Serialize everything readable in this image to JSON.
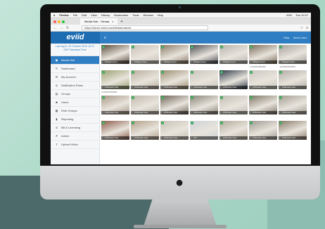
{
  "menubar": {
    "app": "Firefox",
    "items": [
      "File",
      "Edit",
      "View",
      "History",
      "Bookmarks",
      "Tools",
      "Window",
      "Help"
    ],
    "right_items": [
      "99%",
      "Tue 10:37"
    ]
  },
  "browser": {
    "tab_title": "Media Hub - Trimaa",
    "url": "https://demo.eviid.com/Media/Index#/",
    "nav_back": "←",
    "nav_forward": "→",
    "nav_reload": "↻",
    "menu_glyph": "≡",
    "star_glyph": "☆"
  },
  "app": {
    "logo": "eviid",
    "hamburger": "≡",
    "header_right": [
      "Help",
      "demo user"
    ],
    "last_login": "Last log in: 22 October 2019 10:37 GMT Standard Time"
  },
  "sidebar": {
    "items": [
      {
        "label": "Media Hub",
        "icon": "camera-icon",
        "glyph": "▣",
        "active": true
      },
      {
        "label": "Dashboard",
        "icon": "edit-icon",
        "glyph": "✎",
        "active": false
      },
      {
        "label": "My Account",
        "icon": "gear-icon",
        "glyph": "⚙",
        "active": false
      },
      {
        "label": "Notification Rules",
        "icon": "bell-icon",
        "glyph": "◎",
        "active": false
      },
      {
        "label": "Groups",
        "icon": "groups-icon",
        "glyph": "▤",
        "active": false
      },
      {
        "label": "Users",
        "icon": "users-icon",
        "glyph": "☻",
        "active": false
      },
      {
        "label": "Role Groups",
        "icon": "roles-icon",
        "glyph": "▦",
        "active": false
      },
      {
        "label": "Reporting",
        "icon": "chart-icon",
        "glyph": "▮",
        "active": false
      },
      {
        "label": "Bill & Licensing",
        "icon": "bill-icon",
        "glyph": "$",
        "active": false
      },
      {
        "label": "Admin",
        "icon": "wrench-icon",
        "glyph": "✗",
        "active": false
      },
      {
        "label": "Upload Video",
        "icon": "upload-icon",
        "glyph": "⇧",
        "active": false
      }
    ]
  },
  "media": {
    "rows": [
      {
        "thumbs": [
          {
            "caption": "8 Regent Court",
            "color": "#5a4a3a"
          },
          {
            "caption": "8 Regent Court",
            "color": "#c8c0b8"
          },
          {
            "caption": "8 Regent Court",
            "color": "#8a7a66"
          },
          {
            "caption": "8 Regent Court",
            "color": "#4a4a52"
          },
          {
            "caption": "8 Regent Court",
            "color": "#b8b4ae"
          },
          {
            "caption": "8 Regent Court",
            "color": "#7a6a58"
          },
          {
            "caption": "8 Regent Court",
            "color": "#a6a29c"
          }
        ],
        "labels": [
          "",
          "",
          "",
          "",
          "",
          "1234567890ABC",
          "1234567890ABC"
        ]
      },
      {
        "thumbs": [
          {
            "caption": "24 Brussel Crest",
            "color": "#9aa070"
          },
          {
            "caption": "24 Brussel Crest",
            "color": "#b8ae9c"
          },
          {
            "caption": "24 Brussel Crest",
            "color": "#9c8c70"
          },
          {
            "caption": "24 Brussel Crest",
            "color": "#c9c4bb"
          },
          {
            "caption": "24 Brussel Crest",
            "color": "#2e3a48"
          },
          {
            "caption": "24 Brussel Crest",
            "color": "#cbc7c0"
          },
          {
            "caption": "24 Brussel Crest",
            "color": "#b0aca5"
          }
        ],
        "labels": [
          "1234567890ABC",
          "",
          "",
          "",
          "",
          "",
          ""
        ]
      },
      {
        "thumbs": [
          {
            "caption": "24 Brussel Crest",
            "color": "#a89886"
          },
          {
            "caption": "24 Brussel Crest",
            "color": "#bfb8ab"
          },
          {
            "caption": "24 Brussel Crest",
            "color": "#6e6458"
          },
          {
            "caption": "24 Brussel Crest",
            "color": "#8a8478"
          },
          {
            "caption": "24 Brussel Crest",
            "color": "#c2bdb4"
          },
          {
            "caption": "24 Brussel Crest",
            "color": "#7d7466"
          },
          {
            "caption": "24 Brussel Crest",
            "color": "#a39d92"
          }
        ],
        "labels": [
          "",
          "",
          "",
          "",
          "",
          "",
          ""
        ]
      },
      {
        "thumbs": [
          {
            "caption": "24 Brussel Crest",
            "color": "#8c5a4a"
          },
          {
            "caption": "24 Brussel Crest",
            "color": "#b3a08a"
          },
          {
            "caption": "24 Brussel Crest",
            "color": "#c8c2b6"
          },
          {
            "caption": "Test",
            "color": "#cdd2d6"
          },
          {
            "caption": "24 Brussel Crest",
            "color": "#b3aa9c"
          },
          {
            "caption": "24 Brussel Crest",
            "color": "#9e9a92"
          },
          {
            "caption": "24 Brussel Crest",
            "color": "#8a7c6a"
          }
        ],
        "labels": [
          "",
          "",
          "",
          "",
          "",
          "",
          ""
        ]
      }
    ]
  },
  "colors": {
    "brand_blue": "#2f7dc2",
    "badge_green": "#3aa55a",
    "background": "#a8d8c8"
  }
}
